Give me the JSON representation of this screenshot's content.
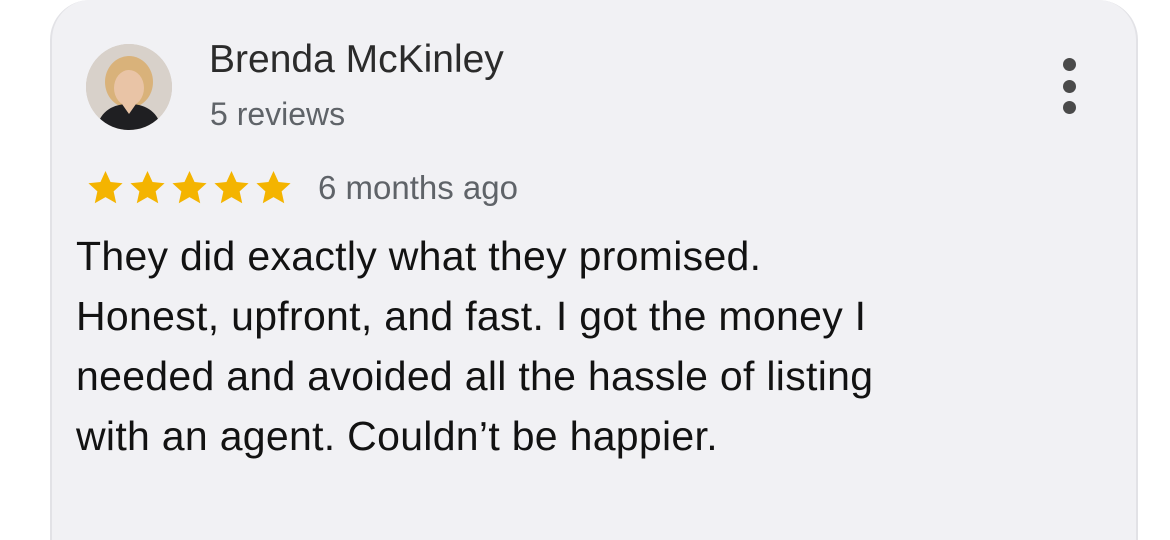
{
  "review": {
    "author": "Brenda McKinley",
    "review_count": "5 reviews",
    "rating": 5,
    "time": "6 months ago",
    "text_lines": [
      "They did exactly what they promised.",
      "Honest, upfront, and fast. I got the money I",
      "needed and avoided all the hassle of listing",
      "with an agent. Couldn’t be happier."
    ]
  },
  "icons": {
    "star": "star-icon",
    "menu": "more-vert-icon",
    "avatar": "avatar-photo"
  },
  "colors": {
    "card_bg": "#f1f1f4",
    "star": "#f4b400",
    "secondary_text": "#5f6368"
  }
}
